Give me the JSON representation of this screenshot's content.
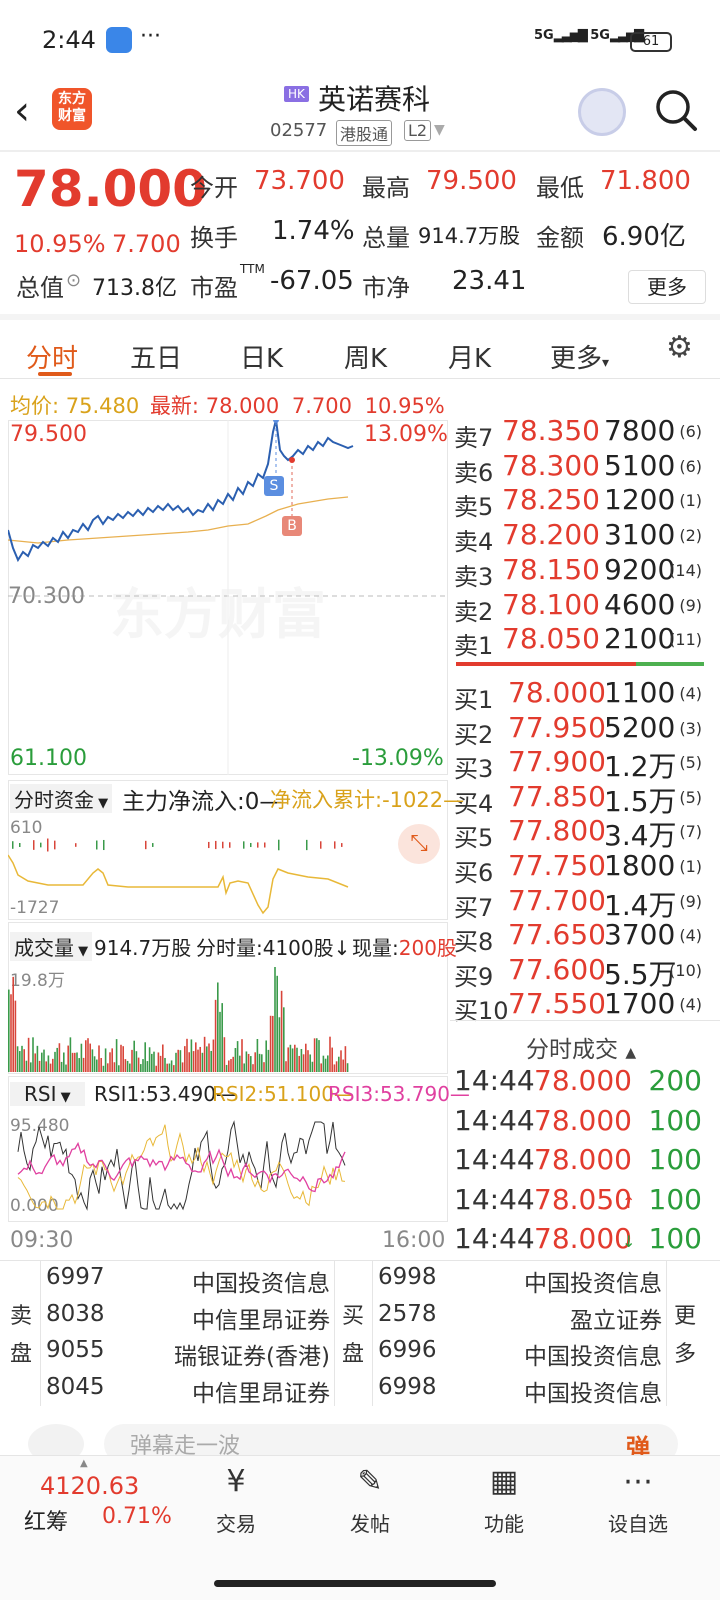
{
  "status_bar": {
    "time": "2:44",
    "dots": "···",
    "signal1": "5G",
    "signal2": "5G",
    "battery": "61"
  },
  "header": {
    "logo": "东方财富",
    "hk_badge": "HK",
    "stock_name": "英诺赛科",
    "code": "02577",
    "tag_connect": "港股通",
    "tag_level": "L2"
  },
  "quote": {
    "price": "78.000",
    "change_pct": "10.95%",
    "change": "7.700",
    "open_label": "今开",
    "open": "73.700",
    "high_label": "最高",
    "high": "79.500",
    "low_label": "最低",
    "low": "71.800",
    "turnover_label": "换手",
    "turnover": "1.74%",
    "volume_label": "总量",
    "volume": "914.7万股",
    "amount_label": "金额",
    "amount": "6.90亿",
    "mktcap_label": "总值",
    "mktcap": "713.8亿",
    "pe_label": "市盈",
    "pe_sup": "TTM",
    "pe": "-67.05",
    "pb_label": "市净",
    "pb": "23.41",
    "more": "更多"
  },
  "tabs": [
    "分时",
    "五日",
    "日K",
    "周K",
    "月K",
    "更多"
  ],
  "avg_bar": {
    "avg_label": "均价:",
    "avg": "75.480",
    "latest_label": "最新:",
    "latest": "78.000",
    "change": "7.700",
    "pct": "10.95%"
  },
  "chart": {
    "y_top": "79.500",
    "y_mid": "70.300",
    "y_bot": "61.100",
    "pct_top": "13.09%",
    "pct_bot": "-13.09%",
    "watermark": "东方财富",
    "marker_s": "S",
    "marker_b": "B",
    "time_start": "09:30",
    "time_end": "16:00"
  },
  "order_book": {
    "asks": [
      {
        "label": "卖7",
        "price": "78.350",
        "vol": "7800",
        "cnt": "(6)"
      },
      {
        "label": "卖6",
        "price": "78.300",
        "vol": "5100",
        "cnt": "(6)"
      },
      {
        "label": "卖5",
        "price": "78.250",
        "vol": "1200",
        "cnt": "(1)"
      },
      {
        "label": "卖4",
        "price": "78.200",
        "vol": "3100",
        "cnt": "(2)"
      },
      {
        "label": "卖3",
        "price": "78.150",
        "vol": "9200",
        "cnt": "(14)"
      },
      {
        "label": "卖2",
        "price": "78.100",
        "vol": "4600",
        "cnt": "(9)"
      },
      {
        "label": "卖1",
        "price": "78.050",
        "vol": "2100",
        "cnt": "(11)"
      }
    ],
    "bids": [
      {
        "label": "买1",
        "price": "78.000",
        "vol": "1100",
        "cnt": "(4)"
      },
      {
        "label": "买2",
        "price": "77.950",
        "vol": "5200",
        "cnt": "(3)"
      },
      {
        "label": "买3",
        "price": "77.900",
        "vol": "1.2万",
        "cnt": "(5)"
      },
      {
        "label": "买4",
        "price": "77.850",
        "vol": "1.5万",
        "cnt": "(5)"
      },
      {
        "label": "买5",
        "price": "77.800",
        "vol": "3.4万",
        "cnt": "(7)"
      },
      {
        "label": "买6",
        "price": "77.750",
        "vol": "1800",
        "cnt": "(1)"
      },
      {
        "label": "买7",
        "price": "77.700",
        "vol": "1.4万",
        "cnt": "(9)"
      },
      {
        "label": "买8",
        "price": "77.650",
        "vol": "3700",
        "cnt": "(4)"
      },
      {
        "label": "买9",
        "price": "77.600",
        "vol": "5.5万",
        "cnt": "(10)"
      },
      {
        "label": "买10",
        "price": "77.550",
        "vol": "1700",
        "cnt": "(4)"
      }
    ]
  },
  "fund": {
    "selector": "分时资金",
    "main_flow": "主力净流入:0—",
    "cum_flow": "净流入累计:-1022—",
    "y_top": "610",
    "y_bot": "-1727"
  },
  "volume_panel": {
    "selector": "成交量",
    "total": "914.7万股",
    "tick_vol": "分时量:4100股↓",
    "cur_label": "现量:",
    "cur": "200股",
    "y_top": "19.8万"
  },
  "rsi_panel": {
    "selector": "RSI",
    "rsi1": "RSI1:53.490—",
    "rsi2": "RSI2:51.100—",
    "rsi3": "RSI3:53.790—",
    "y_top": "95.480",
    "y_bot": "0.000"
  },
  "trades": {
    "title": "分时成交",
    "rows": [
      {
        "time": "14:44",
        "price": "78.000",
        "vol": "200",
        "arrow": ""
      },
      {
        "time": "14:44",
        "price": "78.000",
        "vol": "100",
        "arrow": ""
      },
      {
        "time": "14:44",
        "price": "78.000",
        "vol": "100",
        "arrow": ""
      },
      {
        "time": "14:44",
        "price": "78.050",
        "vol": "100",
        "arrow": "↑"
      },
      {
        "time": "14:44",
        "price": "78.000",
        "vol": "100",
        "arrow": "↓"
      }
    ]
  },
  "brokers": {
    "sell_label": [
      "卖",
      "盘"
    ],
    "buy_label": [
      "买",
      "盘"
    ],
    "more_label": [
      "更",
      "多"
    ],
    "sell": [
      {
        "id": "6997",
        "name": "中国投资信息"
      },
      {
        "id": "8038",
        "name": "中信里昂证券"
      },
      {
        "id": "9055",
        "name": "瑞银证券(香港)"
      },
      {
        "id": "8045",
        "name": "中信里昂证券"
      }
    ],
    "buy": [
      {
        "id": "6998",
        "name": "中国投资信息"
      },
      {
        "id": "2578",
        "name": "盈立证券"
      },
      {
        "id": "6996",
        "name": "中国投资信息"
      },
      {
        "id": "6998",
        "name": "中国投资信息"
      }
    ]
  },
  "comment": {
    "placeholder": "弹幕走一波",
    "btn": "弹"
  },
  "bottom_nav": {
    "index_value": "4120.63",
    "index_name": "红筹",
    "index_pct": "0.71%",
    "items": [
      {
        "label": "交易",
        "icon": "¥"
      },
      {
        "label": "发帖",
        "icon": "✎"
      },
      {
        "label": "功能",
        "icon": "▦"
      },
      {
        "label": "设自选",
        "icon": "⋯"
      }
    ]
  }
}
